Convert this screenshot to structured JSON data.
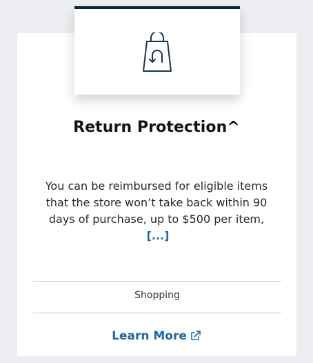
{
  "card": {
    "icon": "shopping-bag-return-icon",
    "title": "Return Protection^",
    "description": "You can be reimbursed for eligible items that the store won’t take back within 90 days of purchase, up to $500 per item,",
    "more_link": "[...]",
    "category": "Shopping",
    "learn_more": "Learn More",
    "learn_more_icon": "external-link-icon"
  },
  "colors": {
    "background": "#eceef1",
    "card": "#ffffff",
    "icon_top_border": "#0f2234",
    "link": "#1e6aa6",
    "text": "#262626"
  }
}
